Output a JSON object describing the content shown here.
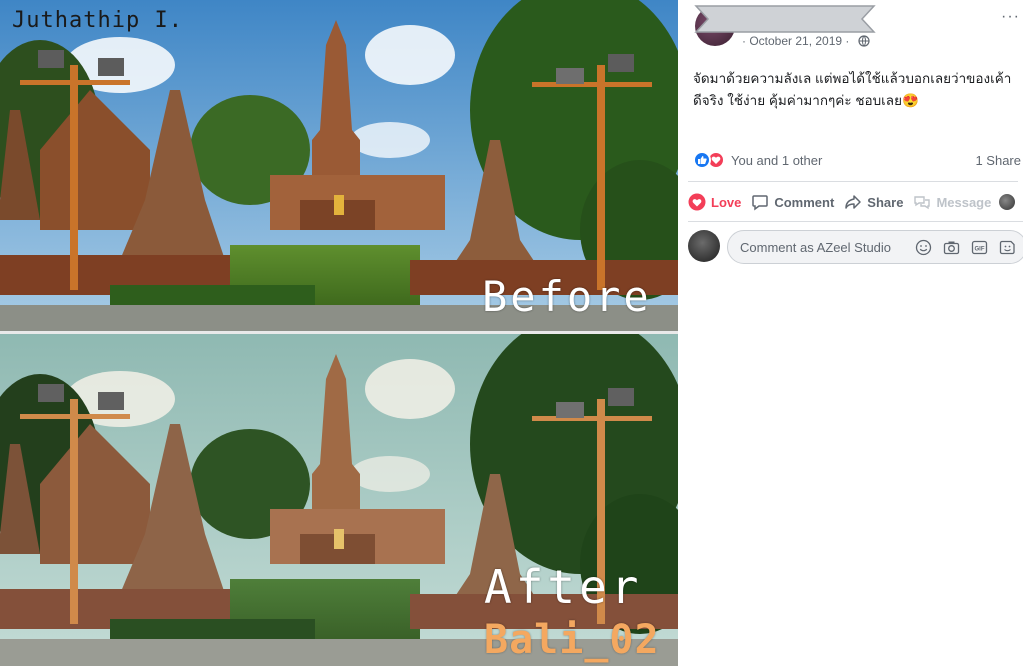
{
  "photo": {
    "author_watermark": "Juthathip I.",
    "before_label": "Before",
    "after_label": "After",
    "preset_label": "Bali_02"
  },
  "post": {
    "date": "· October 21, 2019 ·",
    "text": "จัดมาด้วยความลังเล แต่พอได้ใช้แล้วบอกเลยว่าของเค้าดีจริง ใช้ง่าย คุ้มค่ามากๆค่ะ ชอบเลย😍",
    "reactions_text": "You and 1 other",
    "shares_text": "1 Share",
    "more_label": "···"
  },
  "actions": {
    "love": "Love",
    "comment": "Comment",
    "share": "Share",
    "message": "Message"
  },
  "comment": {
    "placeholder": "Comment as AZeel Studio"
  },
  "colors": {
    "love_red": "#f33e58",
    "like_blue": "#1877f2",
    "secondary_text": "#606770",
    "preset_orange": "#f4a860"
  }
}
